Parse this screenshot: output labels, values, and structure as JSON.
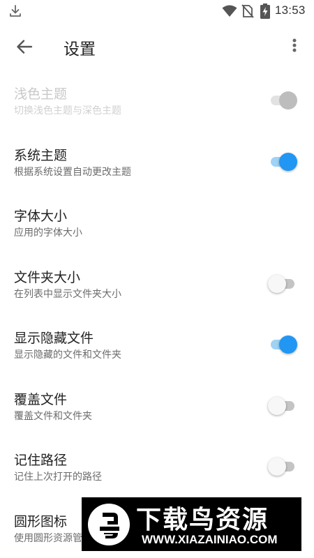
{
  "status_bar": {
    "time": "13:53",
    "icons": [
      "download-icon",
      "wifi-icon",
      "no-sim-icon",
      "battery-charging-icon"
    ]
  },
  "app_bar": {
    "title": "设置",
    "back_icon": "arrow-left-icon",
    "more_icon": "more-vertical-icon"
  },
  "colors": {
    "accent": "#2196f3",
    "accent_track": "#9fd3f5",
    "text_primary": "#222222",
    "text_secondary": "#6b6b6b",
    "disabled_text": "#c8c8c8"
  },
  "settings": [
    {
      "label": "浅色主题",
      "sub": "切换浅色主题与深色主题",
      "toggle": "on",
      "disabled": true
    },
    {
      "label": "系统主题",
      "sub": "根据系统设置自动更改主题",
      "toggle": "on",
      "disabled": false
    },
    {
      "label": "字体大小",
      "sub": "应用的字体大小",
      "toggle": null,
      "disabled": false
    },
    {
      "label": "文件夹大小",
      "sub": "在列表中显示文件夹大小",
      "toggle": "off",
      "disabled": false
    },
    {
      "label": "显示隐藏文件",
      "sub": "显示隐藏的文件和文件夹",
      "toggle": "on",
      "disabled": false
    },
    {
      "label": "覆盖文件",
      "sub": "覆盖文件和文件夹",
      "toggle": "off",
      "disabled": false
    },
    {
      "label": "记住路径",
      "sub": "记住上次打开的路径",
      "toggle": "off",
      "disabled": false
    },
    {
      "label": "圆形图标",
      "sub": "使用圆形资源管",
      "toggle": null,
      "disabled": false
    }
  ],
  "watermark": {
    "title": "下载鸟资源",
    "url": "WWW.XIAZAINIAO.COM"
  }
}
